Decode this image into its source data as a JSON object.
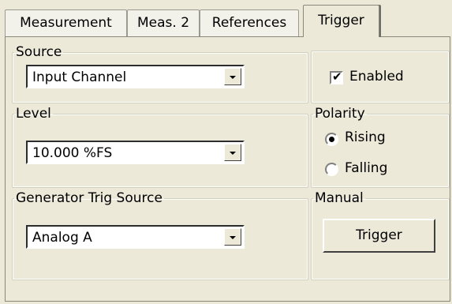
{
  "tabs": [
    {
      "label": "Measurement"
    },
    {
      "label": "Meas. 2"
    },
    {
      "label": "References"
    },
    {
      "label": "Trigger"
    }
  ],
  "source": {
    "legend": "Source",
    "value": "Input Channel"
  },
  "enabled": {
    "label": "Enabled",
    "checked": true
  },
  "level": {
    "legend": "Level",
    "value": "10.000 %FS"
  },
  "polarity": {
    "legend": "Polarity",
    "options": [
      {
        "label": "Rising",
        "selected": true
      },
      {
        "label": "Falling",
        "selected": false
      }
    ]
  },
  "generator": {
    "legend": "Generator Trig Source",
    "value": "Analog A"
  },
  "manual": {
    "legend": "Manual",
    "button_label": "Trigger"
  }
}
